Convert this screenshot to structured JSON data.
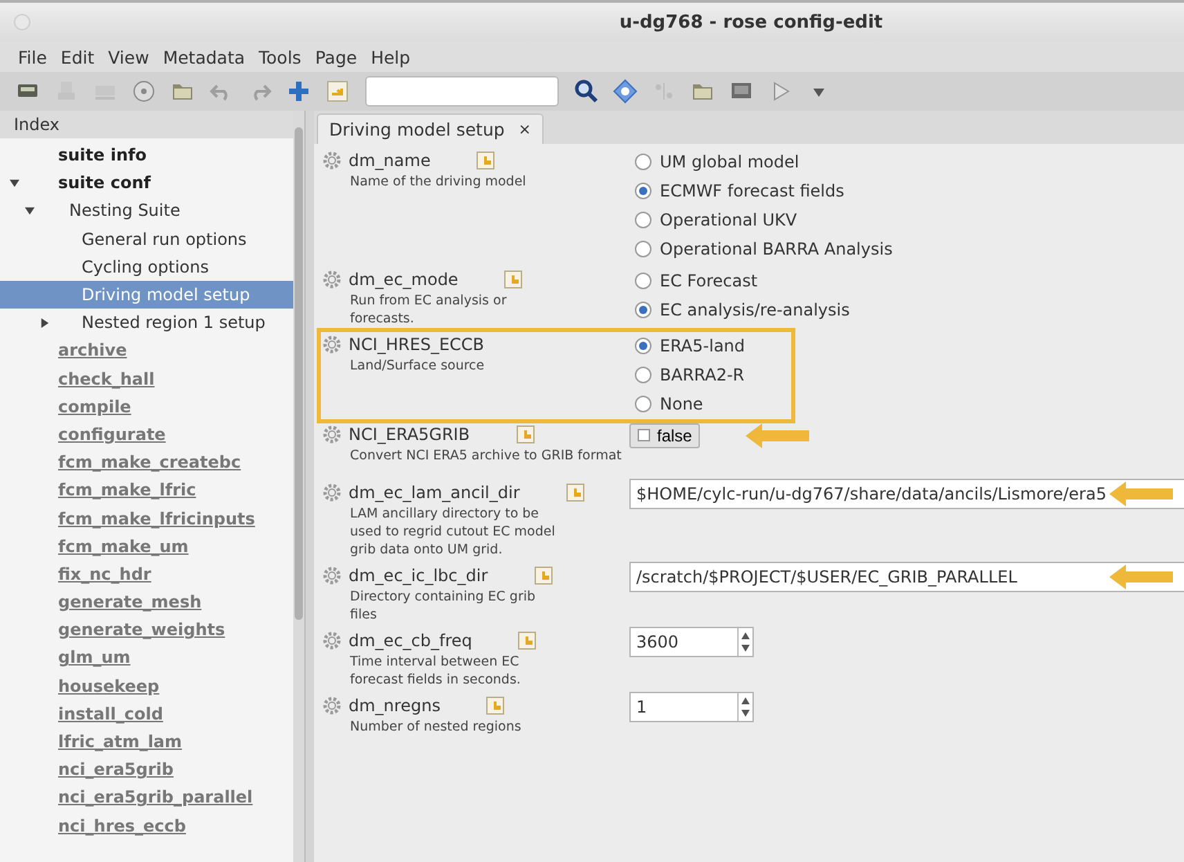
{
  "window": {
    "title": "u-dg768 - rose config-edit"
  },
  "menu": [
    "File",
    "Edit",
    "View",
    "Metadata",
    "Tools",
    "Page",
    "Help"
  ],
  "toolbar": [
    {
      "kind": "drive",
      "disabled": false
    },
    {
      "kind": "save",
      "disabled": true
    },
    {
      "kind": "spell",
      "disabled": true
    },
    {
      "kind": "disc",
      "disabled": false
    },
    {
      "kind": "folder",
      "disabled": false
    },
    {
      "kind": "undo",
      "disabled": true
    },
    {
      "kind": "redo",
      "disabled": true
    },
    {
      "kind": "plus",
      "disabled": false
    },
    {
      "kind": "import",
      "disabled": false
    },
    {
      "kind": "search-field",
      "disabled": false
    },
    {
      "kind": "search",
      "disabled": false
    },
    {
      "kind": "help",
      "disabled": false
    },
    {
      "kind": "diff",
      "disabled": true
    },
    {
      "kind": "folder",
      "disabled": false
    },
    {
      "kind": "screen",
      "disabled": false
    },
    {
      "kind": "play",
      "disabled": true
    },
    {
      "kind": "caret",
      "disabled": false
    }
  ],
  "sidebar": {
    "title": "Index",
    "items": [
      {
        "label": "suite info",
        "kind": "bold",
        "selected": false
      },
      {
        "label": "suite conf",
        "kind": "bold",
        "selected": false,
        "expanded": true,
        "children": [
          {
            "label": "Nesting Suite",
            "kind": "plain",
            "selected": false,
            "expanded": true,
            "children": [
              {
                "label": "General run options",
                "kind": "plain",
                "selected": false
              },
              {
                "label": "Cycling options",
                "kind": "plain",
                "selected": false
              },
              {
                "label": "Driving model setup",
                "kind": "plain",
                "selected": true
              },
              {
                "label": "Nested region 1 setup",
                "kind": "plain",
                "selected": false,
                "expanded": false
              }
            ]
          }
        ]
      },
      {
        "label": "archive",
        "kind": "ignored",
        "selected": false
      },
      {
        "label": "check_hall",
        "kind": "ignored",
        "selected": false
      },
      {
        "label": "compile",
        "kind": "ignored",
        "selected": false
      },
      {
        "label": "configurate",
        "kind": "ignored",
        "selected": false
      },
      {
        "label": "fcm_make_createbc",
        "kind": "ignored",
        "selected": false
      },
      {
        "label": "fcm_make_lfric",
        "kind": "ignored",
        "selected": false
      },
      {
        "label": "fcm_make_lfricinputs",
        "kind": "ignored",
        "selected": false
      },
      {
        "label": "fcm_make_um",
        "kind": "ignored",
        "selected": false
      },
      {
        "label": "fix_nc_hdr",
        "kind": "ignored",
        "selected": false
      },
      {
        "label": "generate_mesh",
        "kind": "ignored",
        "selected": false
      },
      {
        "label": "generate_weights",
        "kind": "ignored",
        "selected": false
      },
      {
        "label": "glm_um",
        "kind": "ignored",
        "selected": false
      },
      {
        "label": "housekeep",
        "kind": "ignored",
        "selected": false
      },
      {
        "label": "install_cold",
        "kind": "ignored",
        "selected": false
      },
      {
        "label": "lfric_atm_lam",
        "kind": "ignored",
        "selected": false
      },
      {
        "label": "nci_era5grib",
        "kind": "ignored",
        "selected": false
      },
      {
        "label": "nci_era5grib_parallel",
        "kind": "ignored",
        "selected": false
      },
      {
        "label": "nci_hres_eccb",
        "kind": "ignored",
        "selected": false
      }
    ]
  },
  "tabs": [
    {
      "label": "Driving model setup",
      "close": "×",
      "selected": true
    }
  ],
  "settings": [
    {
      "name": "dm_name",
      "description": "Name of the driving model",
      "kind": "radio",
      "edit_icon": true,
      "highlighted": false,
      "arrow": false,
      "options": [
        {
          "label": "UM global model",
          "selected": false
        },
        {
          "label": "ECMWF forecast fields",
          "selected": true
        },
        {
          "label": "Operational UKV",
          "selected": false
        },
        {
          "label": "Operational BARRA Analysis",
          "selected": false
        }
      ]
    },
    {
      "name": "dm_ec_mode",
      "description": "Run from EC analysis or forecasts.",
      "kind": "radio",
      "edit_icon": true,
      "highlighted": false,
      "arrow": false,
      "options": [
        {
          "label": "EC Forecast",
          "selected": false
        },
        {
          "label": "EC analysis/re-analysis",
          "selected": true
        }
      ]
    },
    {
      "name": "NCI_HRES_ECCB",
      "description": "Land/Surface source",
      "kind": "radio",
      "edit_icon": false,
      "highlighted": true,
      "arrow": false,
      "options": [
        {
          "label": "ERA5-land",
          "selected": true
        },
        {
          "label": "BARRA2-R",
          "selected": false
        },
        {
          "label": "None",
          "selected": false
        }
      ]
    },
    {
      "name": "NCI_ERA5GRIB",
      "description": "Convert NCI ERA5 archive to GRIB format",
      "kind": "checkbox",
      "edit_icon": true,
      "highlighted": false,
      "arrow": true,
      "value": "false",
      "checked": false
    },
    {
      "name": "dm_ec_lam_ancil_dir",
      "description": "LAM ancillary directory to be used to regrid cutout EC model grib data onto UM grid.",
      "kind": "text",
      "edit_icon": true,
      "highlighted": false,
      "arrow": true,
      "value": "$HOME/cylc-run/u-dg767/share/data/ancils/Lismore/era5"
    },
    {
      "name": "dm_ec_ic_lbc_dir",
      "description": "Directory containing EC grib files",
      "kind": "text",
      "edit_icon": true,
      "highlighted": false,
      "arrow": true,
      "value": "/scratch/$PROJECT/$USER/EC_GRIB_PARALLEL"
    },
    {
      "name": "dm_ec_cb_freq",
      "description": "Time interval between EC forecast fields in seconds.",
      "kind": "spin",
      "edit_icon": true,
      "highlighted": false,
      "arrow": false,
      "value": "3600"
    },
    {
      "name": "dm_nregns",
      "description": "Number of nested regions",
      "kind": "spin",
      "edit_icon": true,
      "highlighted": false,
      "arrow": false,
      "value": "1"
    }
  ]
}
